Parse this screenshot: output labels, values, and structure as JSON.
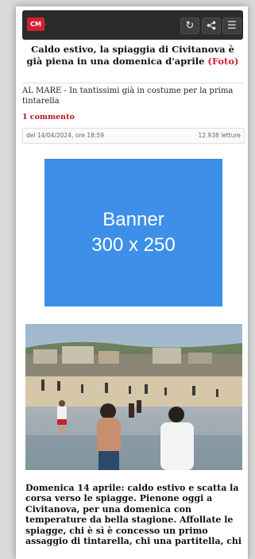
{
  "header": {
    "logo_text": "CM",
    "refresh_icon": "↻",
    "share_icon": "share-icon",
    "menu_icon": "☰"
  },
  "article": {
    "title": "Caldo estivo, la spiaggia di Civitanova è già piena in una domenica d'aprile",
    "title_tag": "(Foto)",
    "subtitle": "AL MARE - In tantissimi già in costume per la prima tintarella",
    "comments": "1 commento",
    "date": "del 14/04/2024, ore 18:59",
    "reads": "12.938 letture",
    "body": "Domenica 14 aprile: caldo estivo e scatta la corsa verso le spiagge. Pienone oggi a Civitanova, per una domenica con temperature da bella stagione. Affollate le spiagge, chi è sì è concesso un primo assaggio di tintarella, chi una partitella, chi"
  },
  "banner": {
    "line1": "Banner",
    "line2": "300 x 250"
  },
  "colors": {
    "accent_red": "#d3202f",
    "banner_blue": "#3d8fe8",
    "topbar": "#2b2b2b"
  }
}
